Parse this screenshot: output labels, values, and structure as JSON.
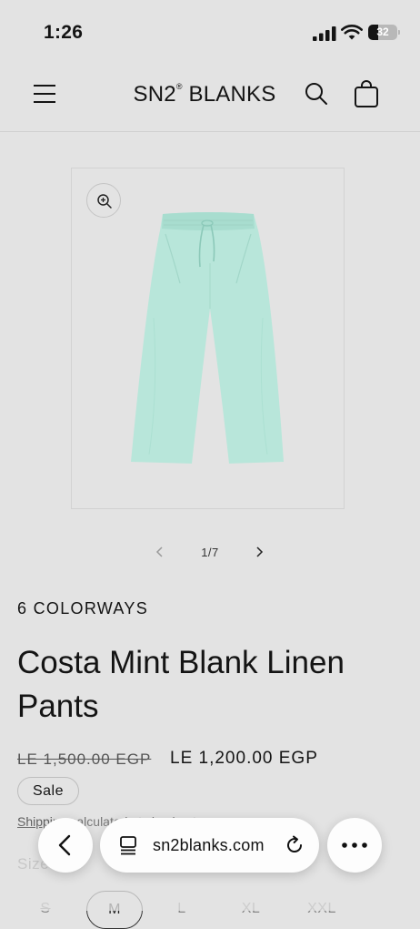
{
  "status_bar": {
    "time": "1:26",
    "battery": "32",
    "battery_fraction": 0.32
  },
  "header": {
    "logo_main": "SN2",
    "logo_mark": "®",
    "logo_tail": " BLANKS"
  },
  "gallery": {
    "image_alt": "Costa Mint Blank Linen Pants",
    "counter": "1/7",
    "product_color": "#b8e6da"
  },
  "product": {
    "colorways": "6 COLORWAYS",
    "title": "Costa Mint Blank Linen Pants",
    "price_original": "LE 1,500.00 EGP",
    "price_sale": "LE 1,200.00 EGP",
    "badge": "Sale",
    "shipping_link": "Shipping",
    "shipping_text": " calculated at checkout.",
    "size_label": "Size",
    "sizes": [
      {
        "label": "S",
        "available": false,
        "selected": false
      },
      {
        "label": "M",
        "available": true,
        "selected": true
      },
      {
        "label": "L",
        "available": true,
        "selected": false
      },
      {
        "label": "XL",
        "available": true,
        "selected": false
      },
      {
        "label": "XXL",
        "available": true,
        "selected": false
      }
    ]
  },
  "browser": {
    "url": "sn2blanks.com"
  },
  "icons": {
    "menu": "hamburger-icon",
    "search": "search-icon",
    "cart": "cart-icon",
    "zoom": "zoom-in-icon",
    "prev": "chevron-left-icon",
    "next": "chevron-right-icon",
    "back": "back-arrow-icon",
    "tabs": "tabs-icon",
    "reload": "reload-icon",
    "more": "more-icon"
  }
}
